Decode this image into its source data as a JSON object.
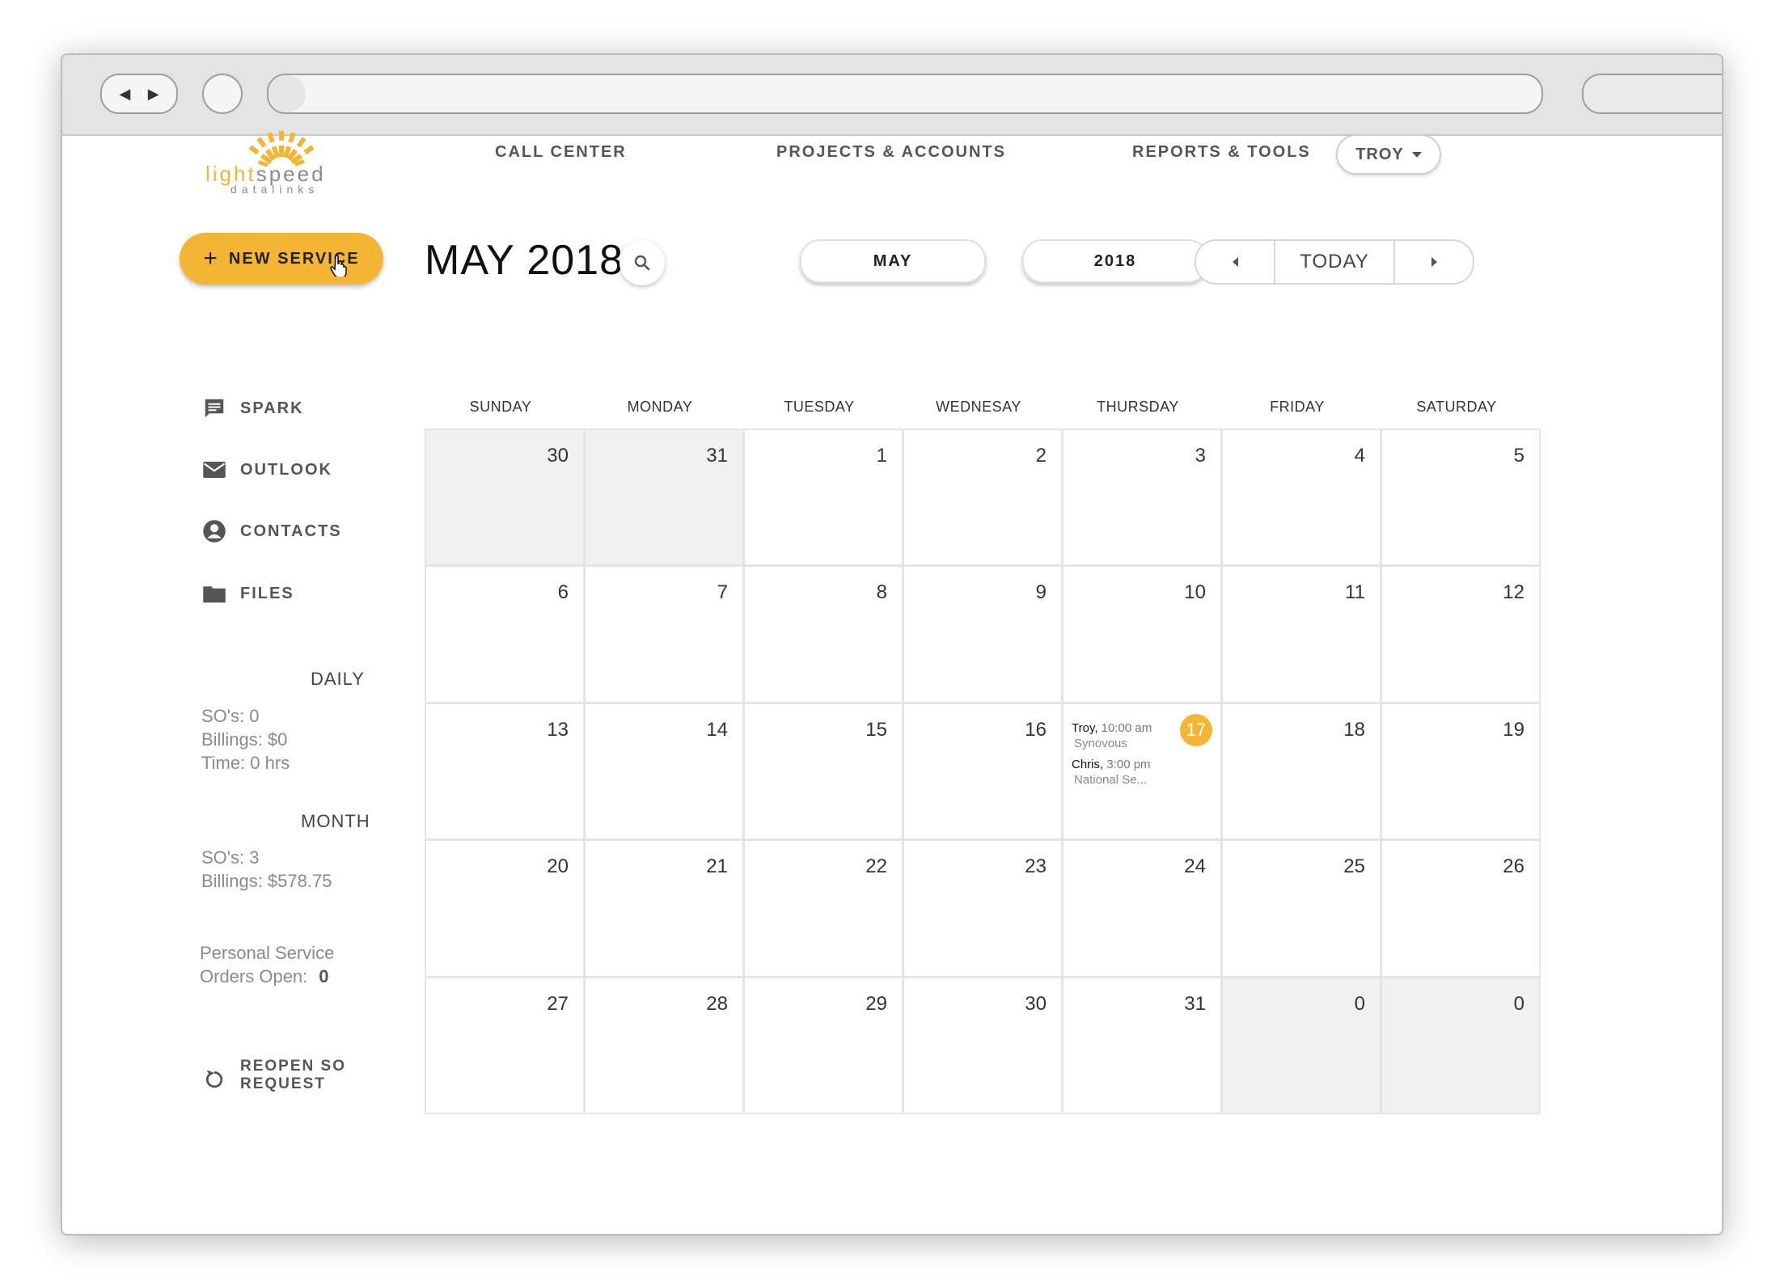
{
  "nav": {
    "call_center": "CALL CENTER",
    "projects_accounts": "PROJECTS & ACCOUNTS",
    "reports_tools": "REPORTS & TOOLS",
    "user": "TROY"
  },
  "logo": {
    "light": "light",
    "speed": "speed",
    "sub": "datalinks"
  },
  "toolbar": {
    "new_service": "NEW SERVICE",
    "title": "MAY 2018",
    "month": "MAY",
    "year": "2018",
    "today": "TODAY"
  },
  "sidebar": {
    "items": [
      {
        "label": "SPARK",
        "icon": "chat-icon"
      },
      {
        "label": "OUTLOOK",
        "icon": "mail-icon"
      },
      {
        "label": "CONTACTS",
        "icon": "account-icon"
      },
      {
        "label": "FILES",
        "icon": "folder-icon"
      }
    ],
    "daily": {
      "title": "DAILY",
      "sos": "SO's: 0",
      "billings": "Billings: $0",
      "time": "Time: 0 hrs"
    },
    "month": {
      "title": "MONTH",
      "sos": "SO's: 3",
      "billings": "Billings: $578.75"
    },
    "personal": {
      "line1": "Personal Service",
      "line2": "Orders Open:",
      "value": "0"
    },
    "reopen": "REOPEN SO REQUEST"
  },
  "calendar": {
    "weekdays": [
      "SUNDAY",
      "MONDAY",
      "TUESDAY",
      "WEDNESAY",
      "THURSDAY",
      "FRIDAY",
      "SATURDAY"
    ],
    "days": [
      "30",
      "31",
      "1",
      "2",
      "3",
      "4",
      "5",
      "6",
      "7",
      "8",
      "9",
      "10",
      "11",
      "12",
      "13",
      "14",
      "15",
      "16",
      "17",
      "18",
      "19",
      "20",
      "21",
      "22",
      "23",
      "24",
      "25",
      "26",
      "27",
      "28",
      "29",
      "30",
      "31",
      "0",
      "0"
    ],
    "events": [
      {
        "who": "Troy,",
        "time": "10:00 am",
        "desc": "Synovous"
      },
      {
        "who": "Chris,",
        "time": "3:00 pm",
        "desc": "National Se..."
      }
    ]
  },
  "colors": {
    "accent": "#f5b534",
    "muted": "#8a8a8a",
    "other_month": "#f1f1f1"
  }
}
